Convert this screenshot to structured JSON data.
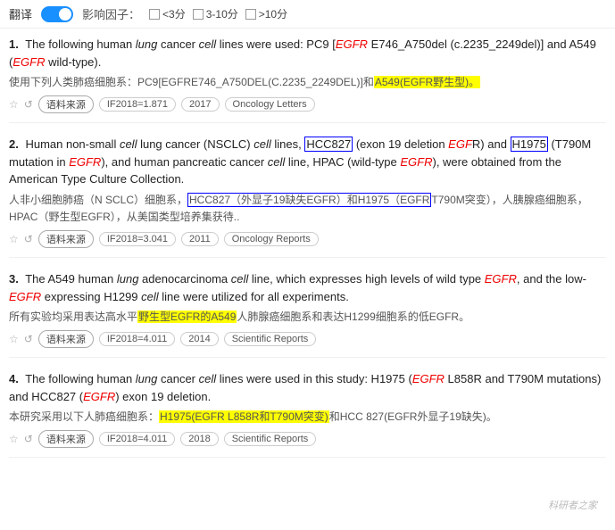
{
  "topbar": {
    "translate_label": "翻译",
    "influence_label": "影响因子：",
    "filter1": "<3分",
    "filter2": "3-10分",
    "filter3": ">10分"
  },
  "results": [
    {
      "num": "1.",
      "en_parts": [
        {
          "text": "The following human ",
          "type": "normal"
        },
        {
          "text": "lung",
          "type": "italic"
        },
        {
          "text": " cancer ",
          "type": "normal"
        },
        {
          "text": "cell",
          "type": "italic"
        },
        {
          "text": " lines were used: PC9 [",
          "type": "normal"
        },
        {
          "text": "EGFR",
          "type": "gene-red"
        },
        {
          "text": " E746_A750del (c.2235_2249del)] and A549 (",
          "type": "normal"
        },
        {
          "text": "EGFR",
          "type": "gene-red"
        },
        {
          "text": " wild-type).",
          "type": "normal"
        }
      ],
      "cn_parts": [
        {
          "text": "使用下列人类肺癌细胞系：PC9[EGFRE746_A750DEL(C.2235_2249DEL)]和",
          "type": "normal"
        },
        {
          "text": "A549(EGFR野生型)。",
          "type": "highlight-yellow"
        }
      ],
      "if_year": "IF2018=1.871",
      "pub_year": "2017",
      "journal": "Oncology Letters"
    },
    {
      "num": "2.",
      "en_parts": [
        {
          "text": "Human non-small ",
          "type": "normal"
        },
        {
          "text": "cell",
          "type": "italic"
        },
        {
          "text": " lung cancer (NSCLC) ",
          "type": "normal"
        },
        {
          "text": "cell",
          "type": "italic"
        },
        {
          "text": " lines, ",
          "type": "normal"
        },
        {
          "text": "HCC827",
          "type": "highlight-blue"
        },
        {
          "text": " (exon 19 deletion ",
          "type": "normal"
        },
        {
          "text": "EGF",
          "type": "gene-red"
        },
        {
          "text": "R) and ",
          "type": "normal"
        },
        {
          "text": "H1975",
          "type": "highlight-blue"
        },
        {
          "text": " (T790M mutation in ",
          "type": "normal"
        },
        {
          "text": "EGFR",
          "type": "gene-red"
        },
        {
          "text": "), and human pancreatic cancer ",
          "type": "normal"
        },
        {
          "text": "cell",
          "type": "italic"
        },
        {
          "text": " line, HPAC (wild-type ",
          "type": "normal"
        },
        {
          "text": "EGFR",
          "type": "gene-red"
        },
        {
          "text": "), were obtained from the American Type Culture Collection.",
          "type": "normal"
        }
      ],
      "cn_parts": [
        {
          "text": "人非小细胞肺癌（N SCLC）细胞系，",
          "type": "normal"
        },
        {
          "text": "HCC827（外显子19缺失EGFR）和H1975（EGFR",
          "type": "highlight-blue"
        },
        {
          "text": "T790M突变），人胰腺癌细胞系，HPAC（野生型EGFR），从美国类型培养集获待..",
          "type": "normal"
        }
      ],
      "if_year": "IF2018=3.041",
      "pub_year": "2011",
      "journal": "Oncology Reports"
    },
    {
      "num": "3.",
      "en_parts": [
        {
          "text": "The A549 human ",
          "type": "normal"
        },
        {
          "text": "lung",
          "type": "italic"
        },
        {
          "text": " adenocarcinoma ",
          "type": "normal"
        },
        {
          "text": "cell",
          "type": "italic"
        },
        {
          "text": " line, which expresses high levels of wild type ",
          "type": "normal"
        },
        {
          "text": "EGFR",
          "type": "gene-red"
        },
        {
          "text": ", and the low-",
          "type": "normal"
        },
        {
          "text": "EGFR",
          "type": "gene-red"
        },
        {
          "text": " expressing H1299 ",
          "type": "normal"
        },
        {
          "text": "cell",
          "type": "italic"
        },
        {
          "text": " line were utilized for all experiments.",
          "type": "normal"
        }
      ],
      "cn_parts": [
        {
          "text": "所有实验均采用表达高水平",
          "type": "normal"
        },
        {
          "text": "野生型EGFR的A549",
          "type": "highlight-yellow"
        },
        {
          "text": "人肺腺癌细胞系和表达H1299细胞系的低EGFR。",
          "type": "normal"
        }
      ],
      "if_year": "IF2018=4.011",
      "pub_year": "2014",
      "journal": "Scientific Reports"
    },
    {
      "num": "4.",
      "en_parts": [
        {
          "text": "The following human ",
          "type": "normal"
        },
        {
          "text": "lung",
          "type": "italic"
        },
        {
          "text": " cancer ",
          "type": "normal"
        },
        {
          "text": "cell",
          "type": "italic"
        },
        {
          "text": " lines were used in this study: H1975 (",
          "type": "normal"
        },
        {
          "text": "EGFR",
          "type": "gene-red"
        },
        {
          "text": " L858R and T790M mutations) and HCC827 (",
          "type": "normal"
        },
        {
          "text": "EGFR",
          "type": "gene-red"
        },
        {
          "text": ") exon 19 deletion.",
          "type": "normal"
        }
      ],
      "cn_parts": [
        {
          "text": "本研究采用以下人肺癌细胞系：",
          "type": "normal"
        },
        {
          "text": "H1975(EGFR L858R和T790M突变)",
          "type": "highlight-yellow"
        },
        {
          "text": "和HCC 827(EGFR外显子19缺失)。",
          "type": "normal"
        }
      ],
      "if_year": "IF2018=4.011",
      "pub_year": "2018",
      "journal": "Scientific Reports"
    }
  ],
  "meta": {
    "source_label": "语料来源",
    "watermark": "科研者之家"
  }
}
